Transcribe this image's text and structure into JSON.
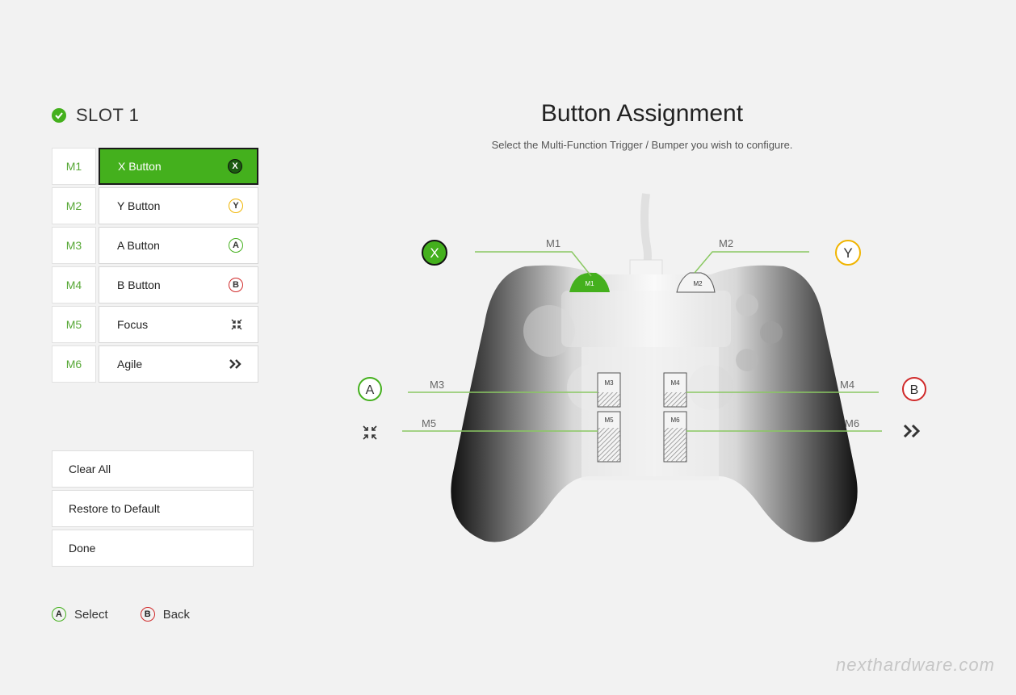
{
  "slot": {
    "title": "SLOT 1"
  },
  "assignments": [
    {
      "slot": "M1",
      "label": "X Button",
      "glyph": "X",
      "color": "#44b01d",
      "selected": true
    },
    {
      "slot": "M2",
      "label": "Y Button",
      "glyph": "Y",
      "color": "#f0b400",
      "selected": false
    },
    {
      "slot": "M3",
      "label": "A Button",
      "glyph": "A",
      "color": "#44b01d",
      "selected": false
    },
    {
      "slot": "M4",
      "label": "B Button",
      "glyph": "B",
      "color": "#d02a2a",
      "selected": false
    },
    {
      "slot": "M5",
      "label": "Focus",
      "icon": "focus-icon",
      "selected": false
    },
    {
      "slot": "M6",
      "label": "Agile",
      "icon": "agile-chevrons-icon",
      "selected": false
    }
  ],
  "actions": {
    "clear": "Clear All",
    "restore": "Restore to Default",
    "done": "Done"
  },
  "footer": {
    "select_glyph": "A",
    "select": "Select",
    "back_glyph": "B",
    "back": "Back"
  },
  "main": {
    "title": "Button Assignment",
    "subtitle": "Select the Multi-Function Trigger / Bumper you wish to configure."
  },
  "controller": {
    "labels": {
      "m1": "M1",
      "m2": "M2",
      "m3": "M3",
      "m4": "M4",
      "m5": "M5",
      "m6": "M6"
    },
    "callouts": {
      "x": "X",
      "y": "Y",
      "a": "A",
      "b": "B"
    }
  },
  "watermark": "nexthardware.com",
  "colors": {
    "accent": "#44b01d",
    "x": "#44b01d",
    "y": "#f0b400",
    "a": "#44b01d",
    "b": "#d02a2a"
  }
}
